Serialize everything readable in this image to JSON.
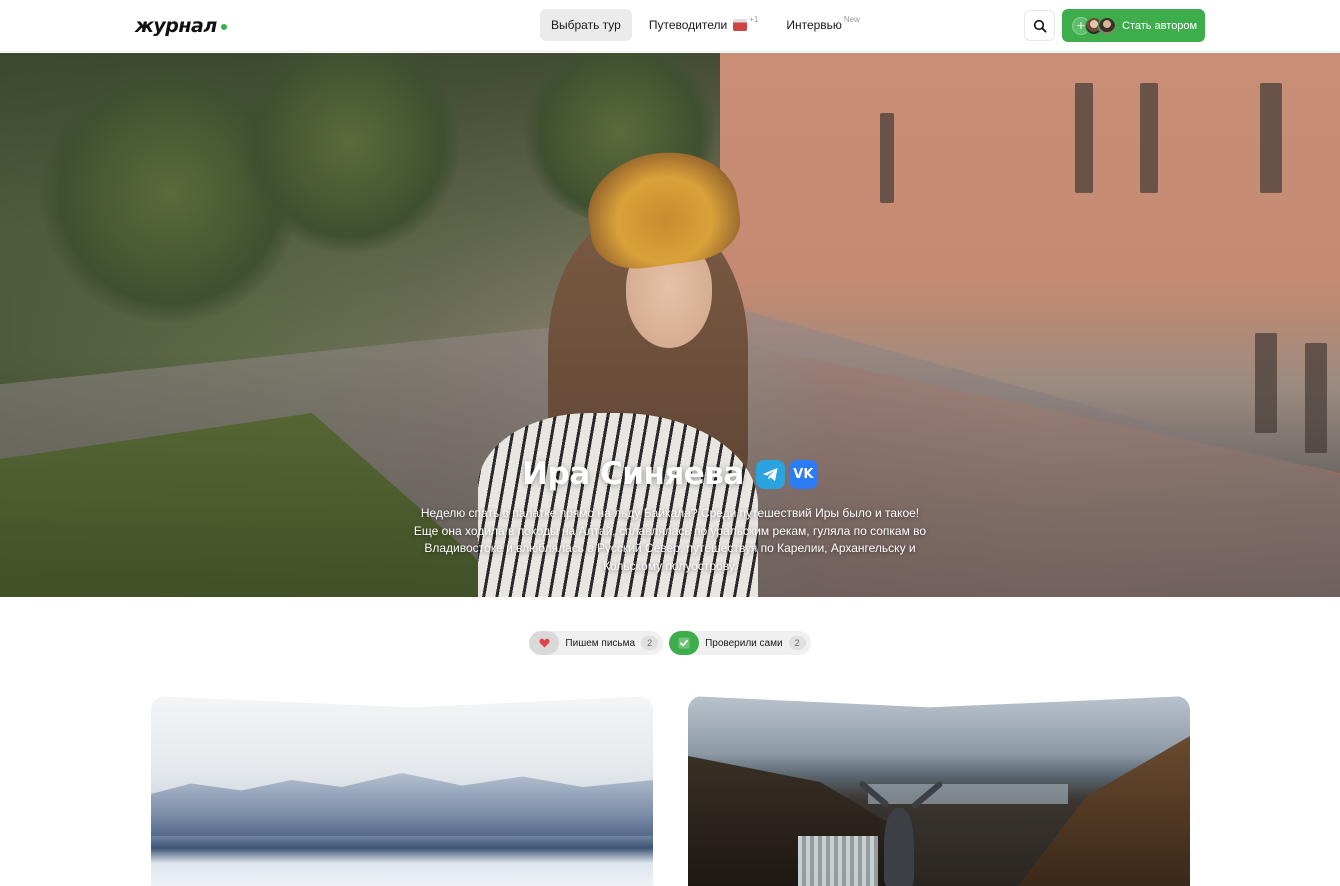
{
  "header": {
    "logo_text": "журнал",
    "nav": [
      {
        "label": "Выбрать тур",
        "active": true
      },
      {
        "label": "Путеводители",
        "sup": "+1"
      },
      {
        "label": "Интервью",
        "sup": "New"
      }
    ],
    "author_button": "Стать автором",
    "search_icon": "search-icon"
  },
  "hero": {
    "name": "Ира Синяева",
    "vk_label": "VK",
    "description": "Неделю спать в палатке прямо на льду Байкала? Среди путешествий Иры было и такое! Еще она ходила в походы на Алтай, сплавлялась по уральским рекам, гуляла по сопкам во Владивостоке и влюблялась в Русский Север, путешествуя по Карелии, Архангельску и Кольскому полуострову."
  },
  "filters": [
    {
      "label": "Пишем письма",
      "count": "2",
      "icon": "heart-icon"
    },
    {
      "label": "Проверили сами",
      "count": "2",
      "icon": "check-icon"
    }
  ],
  "colors": {
    "accent_green": "#3eae4c",
    "telegram_blue": "#2aa3df",
    "vk_blue": "#2c7cf6"
  }
}
